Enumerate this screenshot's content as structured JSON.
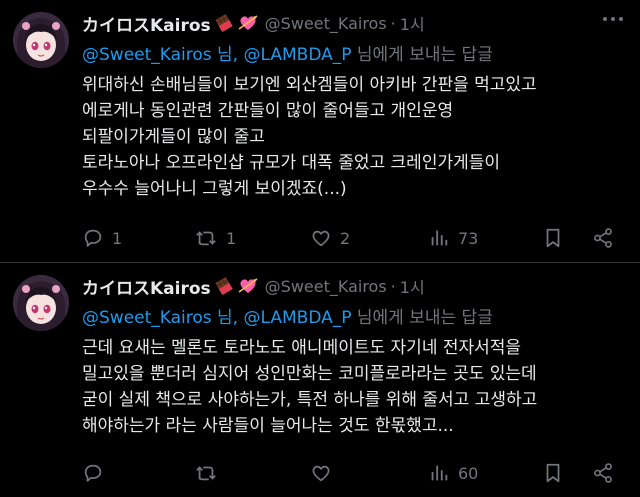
{
  "posts": [
    {
      "author_name": "カイロスKairos",
      "handle": "@Sweet_Kairos",
      "separator": "·",
      "time": "1시",
      "replying_mentions": "@Sweet_Kairos 님, @LAMBDA_P",
      "replying_suffix": " 님에게 보내는 답글",
      "lines": [
        "위대하신 손배님들이 보기엔 외산겜들이 아키바 간판을 먹고있고",
        "에로게나 동인관련 간판들이 많이 줄어들고 개인운영",
        "되팔이가게들이 많이 줄고",
        "토라노아나 오프라인샵 규모가 대폭 줄었고 크레인가게들이",
        "우수수 늘어나니 그렇게 보이겠죠(...)"
      ],
      "replies": "1",
      "retweets": "1",
      "likes": "2",
      "views": "73"
    },
    {
      "author_name": "カイロスKairos",
      "handle": "@Sweet_Kairos",
      "separator": "·",
      "time": "1시",
      "replying_mentions": "@Sweet_Kairos 님, @LAMBDA_P",
      "replying_suffix": " 님에게 보내는 답글",
      "lines": [
        "근데 요새는 멜론도 토라노도 애니메이트도 자기네 전자서적을",
        "밀고있을 뿐더러 심지어 성인만화는 코미플로라라는 곳도 있는데",
        "굳이 실제 책으로 사야하는가, 특전 하나를 위해 줄서고 고생하고",
        "해야하는가 라는 사람들이 늘어나는 것도 한몫했고..."
      ],
      "replies": "",
      "retweets": "",
      "likes": "",
      "views": "60"
    }
  ],
  "icons": {
    "reply": "reply-icon",
    "retweet": "retweet-icon",
    "like": "heart-icon",
    "views": "views-icon",
    "bookmark": "bookmark-icon",
    "share": "share-icon",
    "more": "more-icon"
  },
  "colors": {
    "background": "#000000",
    "text": "#e7e9ea",
    "muted": "#71767b",
    "link": "#1d9bf0"
  }
}
